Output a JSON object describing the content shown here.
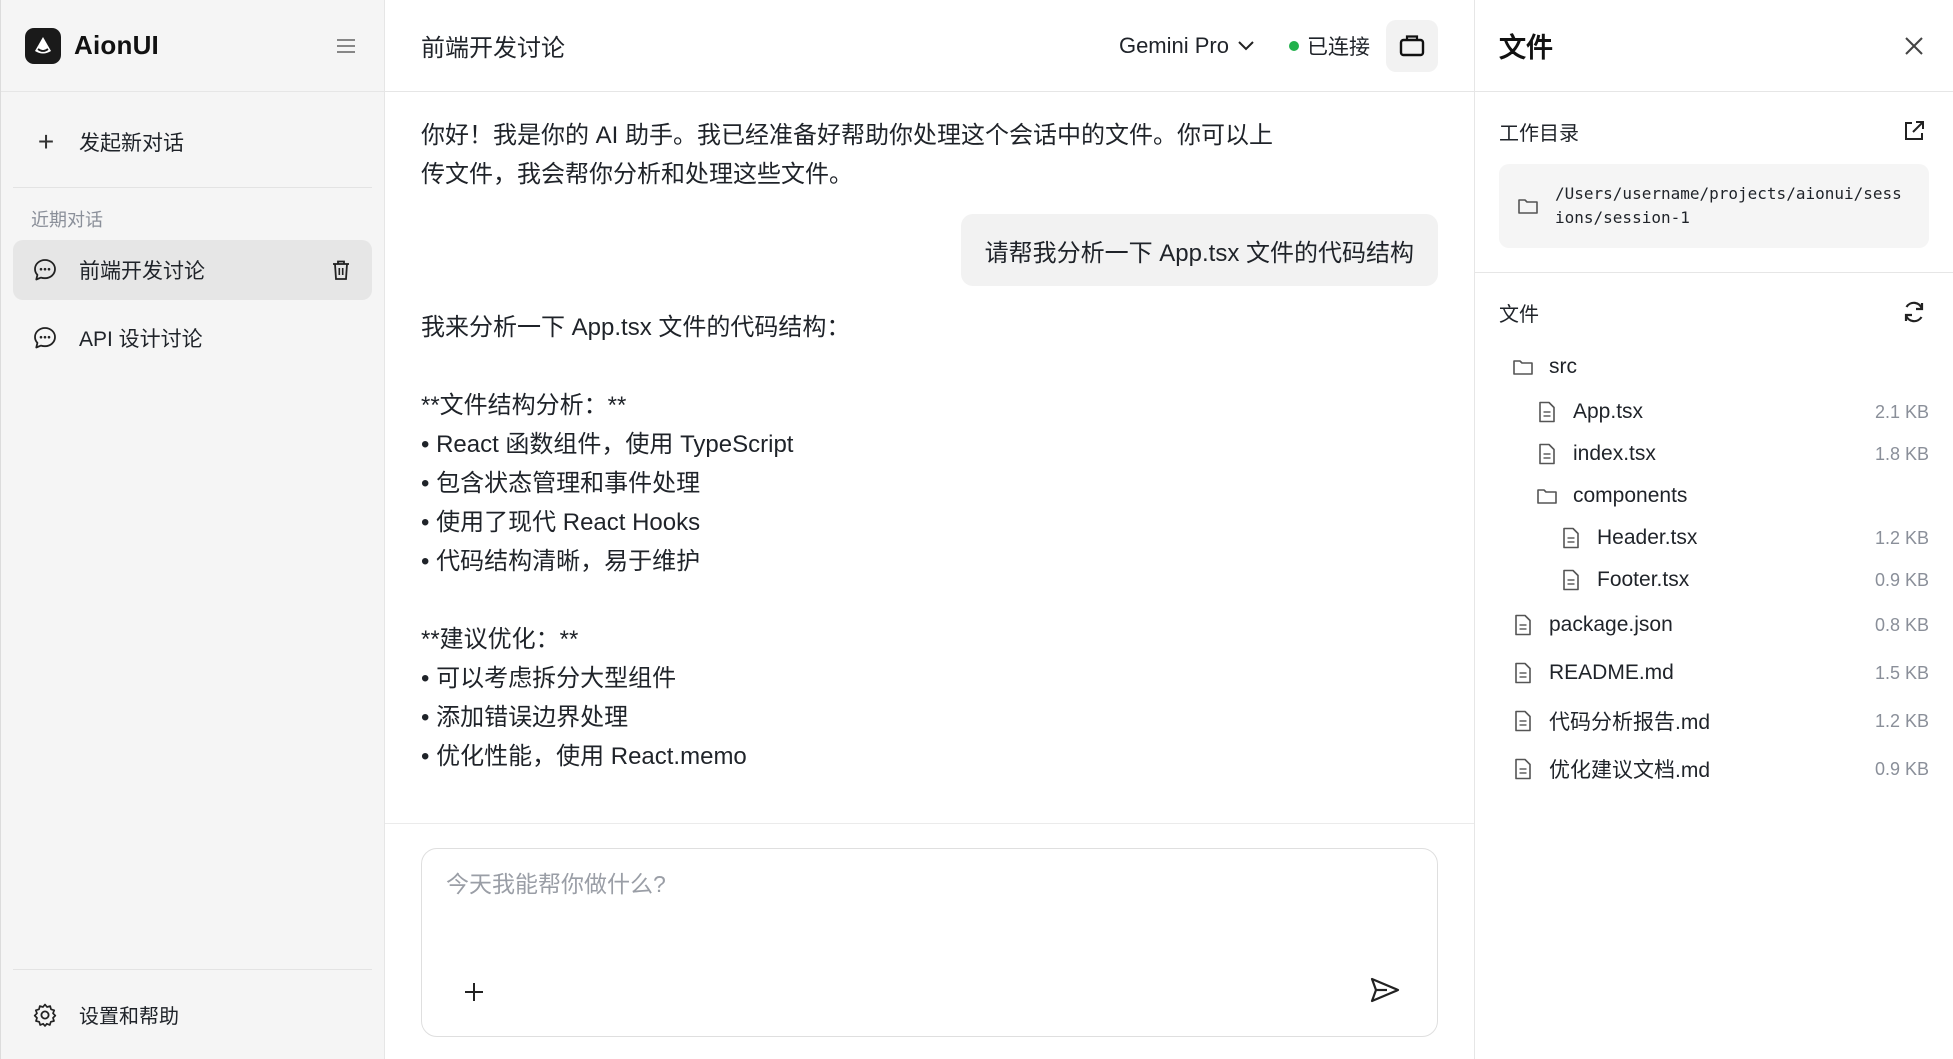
{
  "sidebar": {
    "brand_name": "AionUI",
    "new_chat_label": "发起新对话",
    "recent_label": "近期对话",
    "conversations": [
      {
        "label": "前端开发讨论"
      },
      {
        "label": "API 设计讨论"
      }
    ],
    "settings_label": "设置和帮助"
  },
  "header": {
    "title": "前端开发讨论",
    "model": "Gemini Pro",
    "status": "已连接",
    "status_color": "#22b14c"
  },
  "messages": {
    "ai_greeting": "你好！我是你的 AI 助手。我已经准备好帮助你处理这个会话中的文件。你可以上传文件，我会帮你分析和处理这些文件。",
    "user_message": "请帮我分析一下 App.tsx 文件的代码结构",
    "ai_reply": "我来分析一下 App.tsx 文件的代码结构：\n\n**文件结构分析：**\n• React 函数组件，使用 TypeScript\n• 包含状态管理和事件处理\n• 使用了现代 React Hooks\n• 代码结构清晰，易于维护\n\n**建议优化：**\n• 可以考虑拆分大型组件\n• 添加错误边界处理\n• 优化性能，使用 React.memo"
  },
  "composer": {
    "placeholder": "今天我能帮你做什么?"
  },
  "panel": {
    "title": "文件",
    "workdir_label": "工作目录",
    "workdir_path": "/Users/username/projects/aionui/sessions/session-1",
    "files_label": "文件",
    "tree": [
      {
        "name": "src",
        "type": "folder",
        "size": ""
      },
      {
        "name": "App.tsx",
        "type": "file",
        "size": "2.1 KB"
      },
      {
        "name": "index.tsx",
        "type": "file",
        "size": "1.8 KB"
      },
      {
        "name": "components",
        "type": "folder",
        "size": ""
      },
      {
        "name": "Header.tsx",
        "type": "file",
        "size": "1.2 KB"
      },
      {
        "name": "Footer.tsx",
        "type": "file",
        "size": "0.9 KB"
      },
      {
        "name": "package.json",
        "type": "file",
        "size": "0.8 KB"
      },
      {
        "name": "README.md",
        "type": "file",
        "size": "1.5 KB"
      },
      {
        "name": "代码分析报告.md",
        "type": "file",
        "size": "1.2 KB"
      },
      {
        "name": "优化建议文档.md",
        "type": "file",
        "size": "0.9 KB"
      }
    ]
  }
}
